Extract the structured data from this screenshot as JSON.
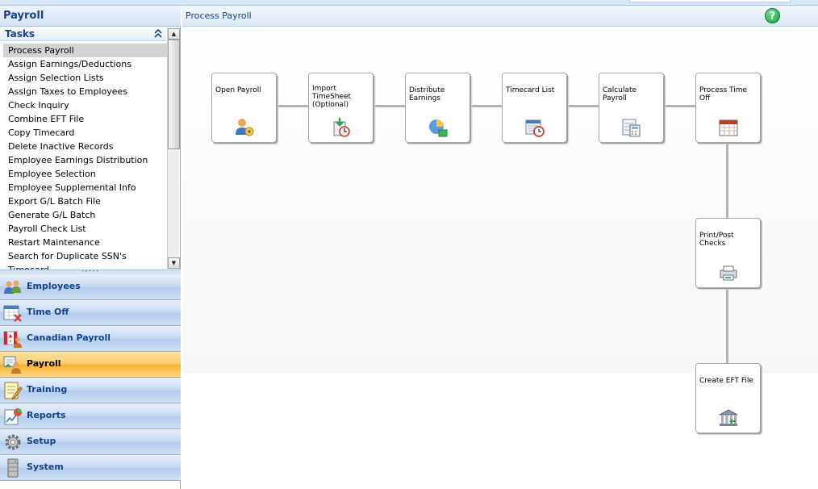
{
  "left_pane": {
    "title": "Payroll",
    "tasks_title": "Tasks",
    "tasks": [
      "Process Payroll",
      "Assign Earnings/Deductions",
      "Assign Selection Lists",
      "Assign Taxes to Employees",
      "Check Inquiry",
      "Combine EFT File",
      "Copy Timecard",
      "Delete Inactive Records",
      "Employee Earnings Distribution",
      "Employee Selection",
      "Employee Supplemental Info",
      "Export G/L Batch File",
      "Generate G/L Batch",
      "Payroll Check List",
      "Restart Maintenance",
      "Search for Duplicate SSN's",
      "Timecard"
    ],
    "selected_task": "Process Payroll",
    "nav": [
      {
        "label": "Employees",
        "icon": "people-icon"
      },
      {
        "label": "Time Off",
        "icon": "calendar-x-icon"
      },
      {
        "label": "Canadian Payroll",
        "icon": "canada-flag-person-icon"
      },
      {
        "label": "Payroll",
        "icon": "payroll-person-icon"
      },
      {
        "label": "Training",
        "icon": "notepad-icon"
      },
      {
        "label": "Reports",
        "icon": "report-chart-icon"
      },
      {
        "label": "Setup",
        "icon": "gear-icon"
      },
      {
        "label": "System",
        "icon": "server-icon"
      }
    ],
    "active_nav": "Payroll"
  },
  "main": {
    "title": "Process Payroll",
    "help_glyph": "?",
    "steps": [
      {
        "label": "Open Payroll",
        "icon": "person-open-icon"
      },
      {
        "label": "Import\nTimeSheet\n(Optional)",
        "icon": "import-clock-icon"
      },
      {
        "label": "Distribute\nEarnings",
        "icon": "pie-chart-icon"
      },
      {
        "label": "Timecard List",
        "icon": "timecard-clock-icon"
      },
      {
        "label": "Calculate\nPayroll",
        "icon": "calculator-sheet-icon"
      },
      {
        "label": "Process Time\nOff",
        "icon": "calendar-icon"
      },
      {
        "label": "Print/Post\nChecks",
        "icon": "printer-icon"
      },
      {
        "label": "Create EFT File",
        "icon": "bank-icon"
      }
    ]
  },
  "colors": {
    "accent": "#15428b",
    "active_nav": "#f7b02d",
    "help": "#1a9a45"
  }
}
